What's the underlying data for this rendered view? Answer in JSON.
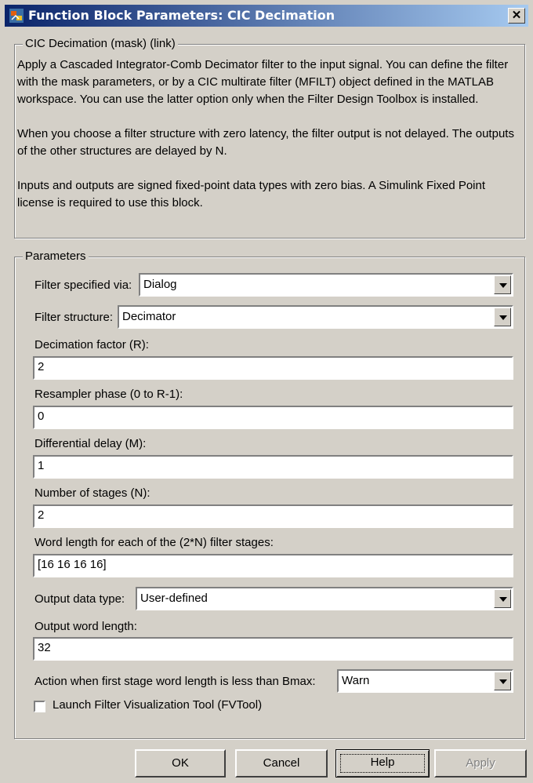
{
  "window": {
    "title": "Function Block Parameters: CIC Decimation",
    "close_glyph": "✕",
    "icon": "block-parameters-icon"
  },
  "description": {
    "legend": "CIC Decimation (mask) (link)",
    "paragraphs": [
      "Apply a Cascaded Integrator-Comb Decimator filter to the input signal. You can define the filter with the mask parameters, or by a CIC multirate filter (MFILT) object defined in the MATLAB workspace. You can use the latter option only when the Filter Design Toolbox is installed.",
      "When you choose a filter structure with zero latency, the filter output is not delayed. The outputs of the other structures are delayed by N.",
      "Inputs and outputs are signed fixed-point data types with zero bias.  A Simulink Fixed Point license is required to use this block."
    ]
  },
  "parameters": {
    "legend": "Parameters",
    "filter_specified_via": {
      "label": "Filter specified via:",
      "value": "Dialog"
    },
    "filter_structure": {
      "label": "Filter structure:",
      "value": "Decimator"
    },
    "decimation_factor": {
      "label": "Decimation factor (R):",
      "value": "2"
    },
    "resampler_phase": {
      "label": "Resampler phase (0 to R-1):",
      "value": "0"
    },
    "differential_delay": {
      "label": "Differential delay (M):",
      "value": "1"
    },
    "number_of_stages": {
      "label": "Number of stages (N):",
      "value": "2"
    },
    "word_length_stages": {
      "label": "Word length for each of the (2*N) filter stages:",
      "value": "[16 16 16 16]"
    },
    "output_data_type": {
      "label": "Output data type:",
      "value": "User-defined"
    },
    "output_word_length": {
      "label": "Output word length:",
      "value": "32"
    },
    "action_first_stage": {
      "label": "Action when first stage word length is less than Bmax:",
      "value": "Warn"
    },
    "launch_fvtool": {
      "label": "Launch Filter Visualization Tool (FVTool)",
      "checked": false
    }
  },
  "buttons": {
    "ok": "OK",
    "cancel": "Cancel",
    "help": "Help",
    "apply": "Apply"
  },
  "colors": {
    "dialog_bg": "#d4d0c8",
    "titlebar_start": "#0a246a",
    "titlebar_end": "#a6caf0",
    "disabled_text": "#808080"
  }
}
